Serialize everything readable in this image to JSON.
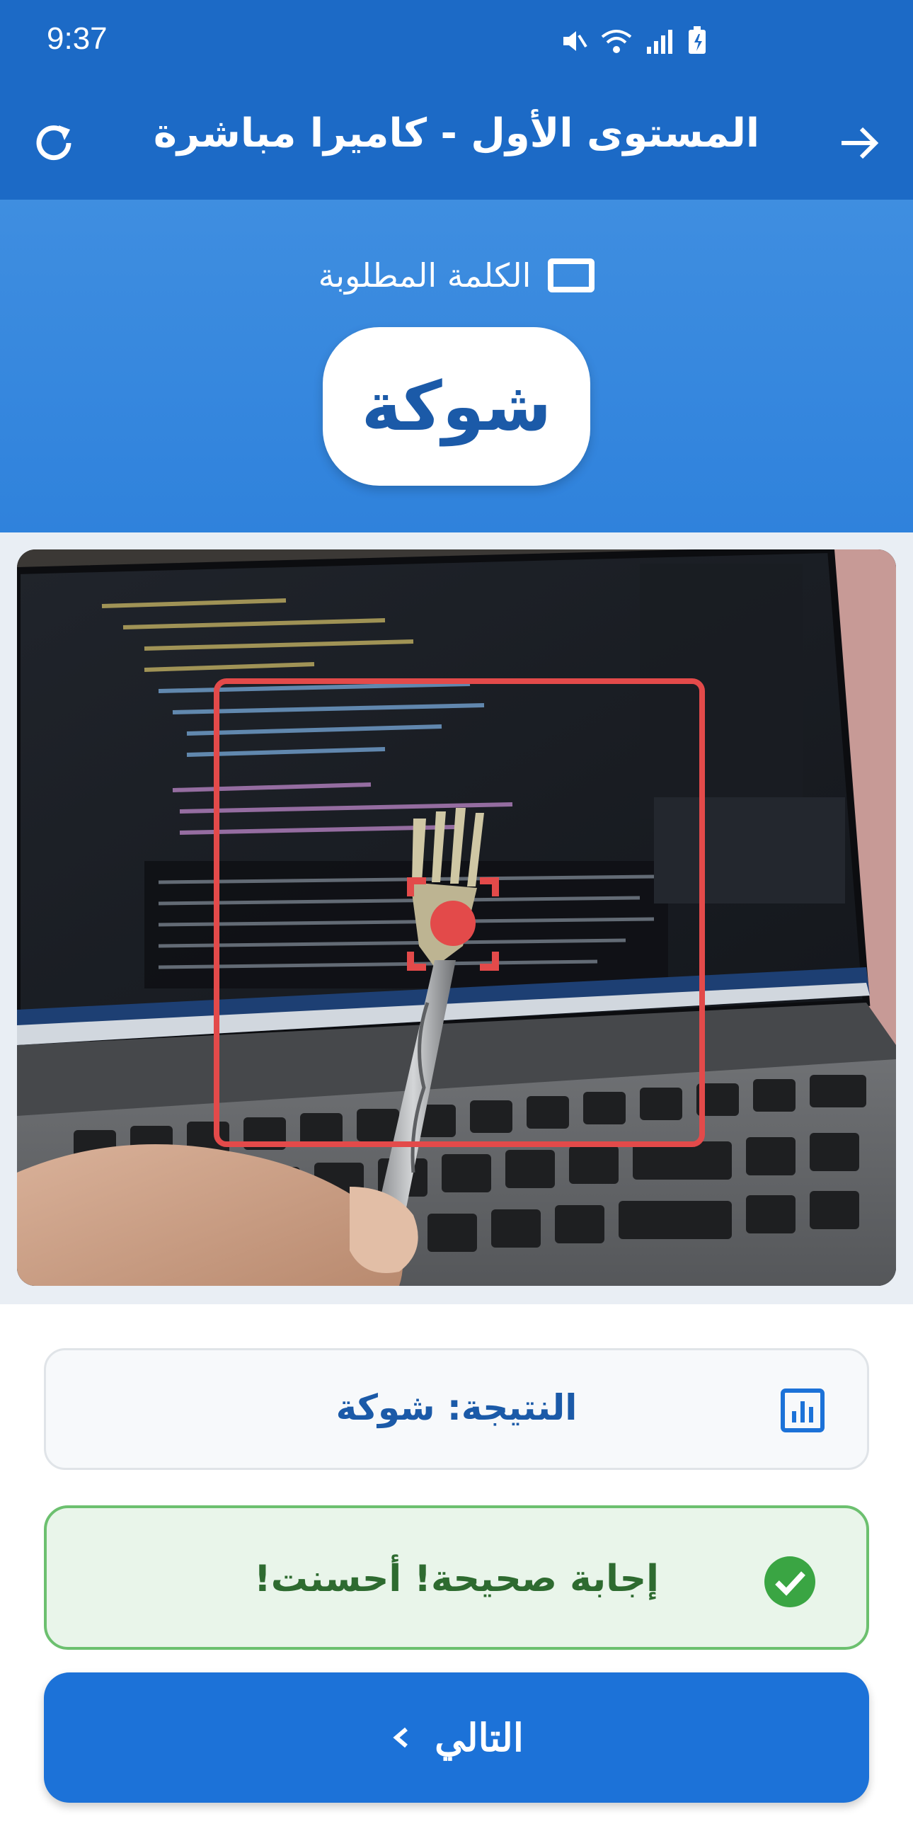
{
  "status_bar": {
    "time": "9:37",
    "icons": [
      "mute-icon",
      "wifi-icon",
      "signal-icon",
      "battery-icon"
    ]
  },
  "app_bar": {
    "title": "المستوى الأول - كاميرا مباشرة",
    "refresh_icon": "refresh-icon",
    "back_icon": "arrow-right-icon"
  },
  "target": {
    "label": "الكلمة المطلوبة",
    "word": "شوكة"
  },
  "camera": {
    "detection_box_color": "#e34a4a"
  },
  "result": {
    "text": "النتيجة: شوكة",
    "icon": "analytics-icon"
  },
  "feedback": {
    "text": "إجابة صحيحة! أحسنت!",
    "icon": "check-circle-icon",
    "color": "#3aa543"
  },
  "next_button": {
    "label": "التالي",
    "icon": "chevron-left-icon"
  },
  "colors": {
    "primary": "#1c6ac6",
    "accent": "#2f82dc",
    "success": "#3aa543"
  }
}
